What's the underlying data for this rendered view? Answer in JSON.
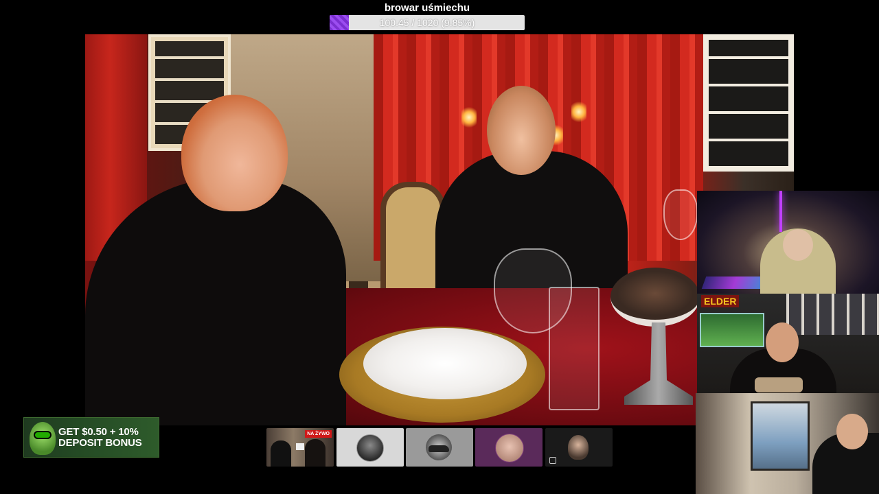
{
  "goal": {
    "title": "browar uśmiechu",
    "progress_text": "100.45 / 1020 (9.85%)",
    "current": 100.45,
    "target": 1020,
    "percent": 9.85,
    "fill_color": "#8b3fe0"
  },
  "banner": {
    "line1": "GET $0.50 + 10%",
    "line2": "DEPOSIT BONUS"
  },
  "webcams": {
    "middle_logo": "ELDER"
  },
  "stream_thumbs": {
    "live_badge": "NA ŻYWO"
  }
}
